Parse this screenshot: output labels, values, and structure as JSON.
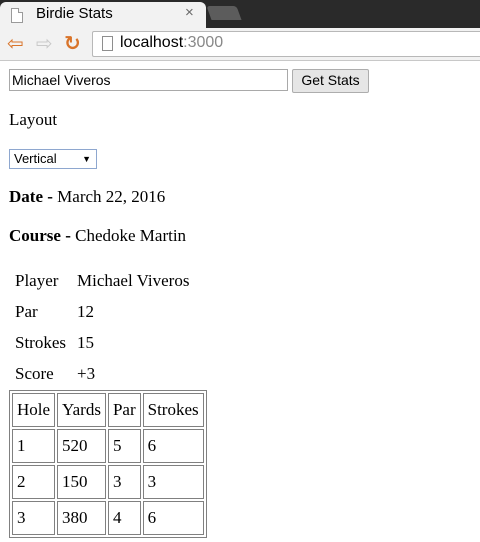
{
  "browser": {
    "tab_title": "Birdie Stats",
    "tab_close": "×",
    "url_host": "localhost",
    "url_port": ":3000"
  },
  "form": {
    "player_value": "Michael Viveros",
    "get_stats_label": "Get Stats",
    "layout_label": "Layout",
    "layout_selected": "Vertical"
  },
  "round": {
    "date_label": "Date - ",
    "date_value": "March 22, 2016",
    "course_label": "Course - ",
    "course_value": "Chedoke Martin"
  },
  "summary": [
    {
      "key": "Player",
      "value": "Michael Viveros"
    },
    {
      "key": "Par",
      "value": "12"
    },
    {
      "key": "Strokes",
      "value": "15"
    },
    {
      "key": "Score",
      "value": "+3"
    }
  ],
  "holes_table": {
    "headers": [
      "Hole",
      "Yards",
      "Par",
      "Strokes"
    ],
    "rows": [
      [
        "1",
        "520",
        "5",
        "6"
      ],
      [
        "2",
        "150",
        "3",
        "3"
      ],
      [
        "3",
        "380",
        "4",
        "6"
      ]
    ]
  }
}
